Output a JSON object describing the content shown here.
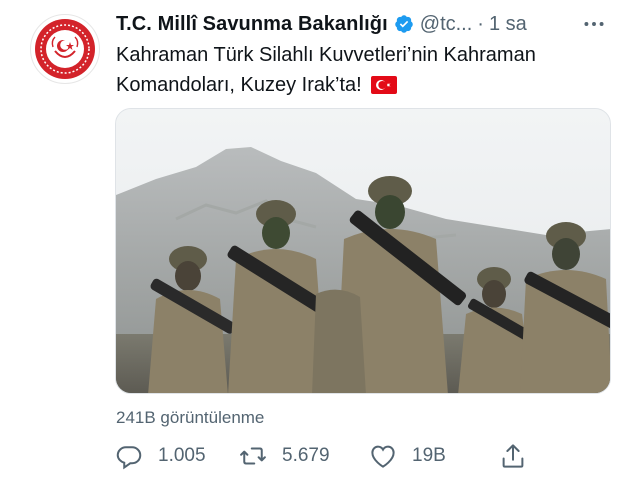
{
  "account": {
    "name": "T.C. Millî Savunma Bakanlığı",
    "handle": "@tc...",
    "separator": "·",
    "time": "1 sa",
    "verified": true,
    "avatar_icon": "msb-emblem-icon"
  },
  "tweet": {
    "text": "Kahraman Türk Silahlı Kuvvetleri’nin Kahraman Komandoları, Kuzey Irak’ta!",
    "emoji": "turkey-flag-icon"
  },
  "media": {
    "icon": "soldiers-photo"
  },
  "stats": {
    "views": "241B görüntülenme"
  },
  "actions": {
    "reply_count": "1.005",
    "retweet_count": "5.679",
    "like_count": "19B",
    "share_icon": "share-icon"
  },
  "colors": {
    "text": "#0f1419",
    "secondary": "#536471",
    "verified": "#1d9bf0",
    "emblem_red": "#d3232a"
  }
}
